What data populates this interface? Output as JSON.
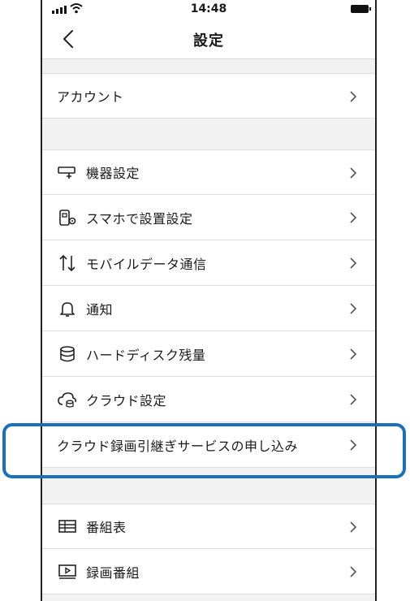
{
  "status_bar": {
    "time": "14:48"
  },
  "nav": {
    "title": "設定"
  },
  "items": [
    {
      "label": "アカウント",
      "icon": "none"
    },
    {
      "label": "機器設定",
      "icon": "device-icon"
    },
    {
      "label": "スマホで設置設定",
      "icon": "phone-setup-icon"
    },
    {
      "label": "モバイルデータ通信",
      "icon": "data-transfer-icon"
    },
    {
      "label": "通知",
      "icon": "bell-icon"
    },
    {
      "label": "ハードディスク残量",
      "icon": "database-icon"
    },
    {
      "label": "クラウド設定",
      "icon": "cloud-icon"
    },
    {
      "label": "クラウド録画引継ぎサービスの申し込み",
      "icon": "none"
    },
    {
      "label": "番組表",
      "icon": "program-guide-icon"
    },
    {
      "label": "録画番組",
      "icon": "recorded-program-icon"
    }
  ],
  "colors": {
    "highlight": "#1a6fbf",
    "group_background": "#f2f2f2"
  }
}
